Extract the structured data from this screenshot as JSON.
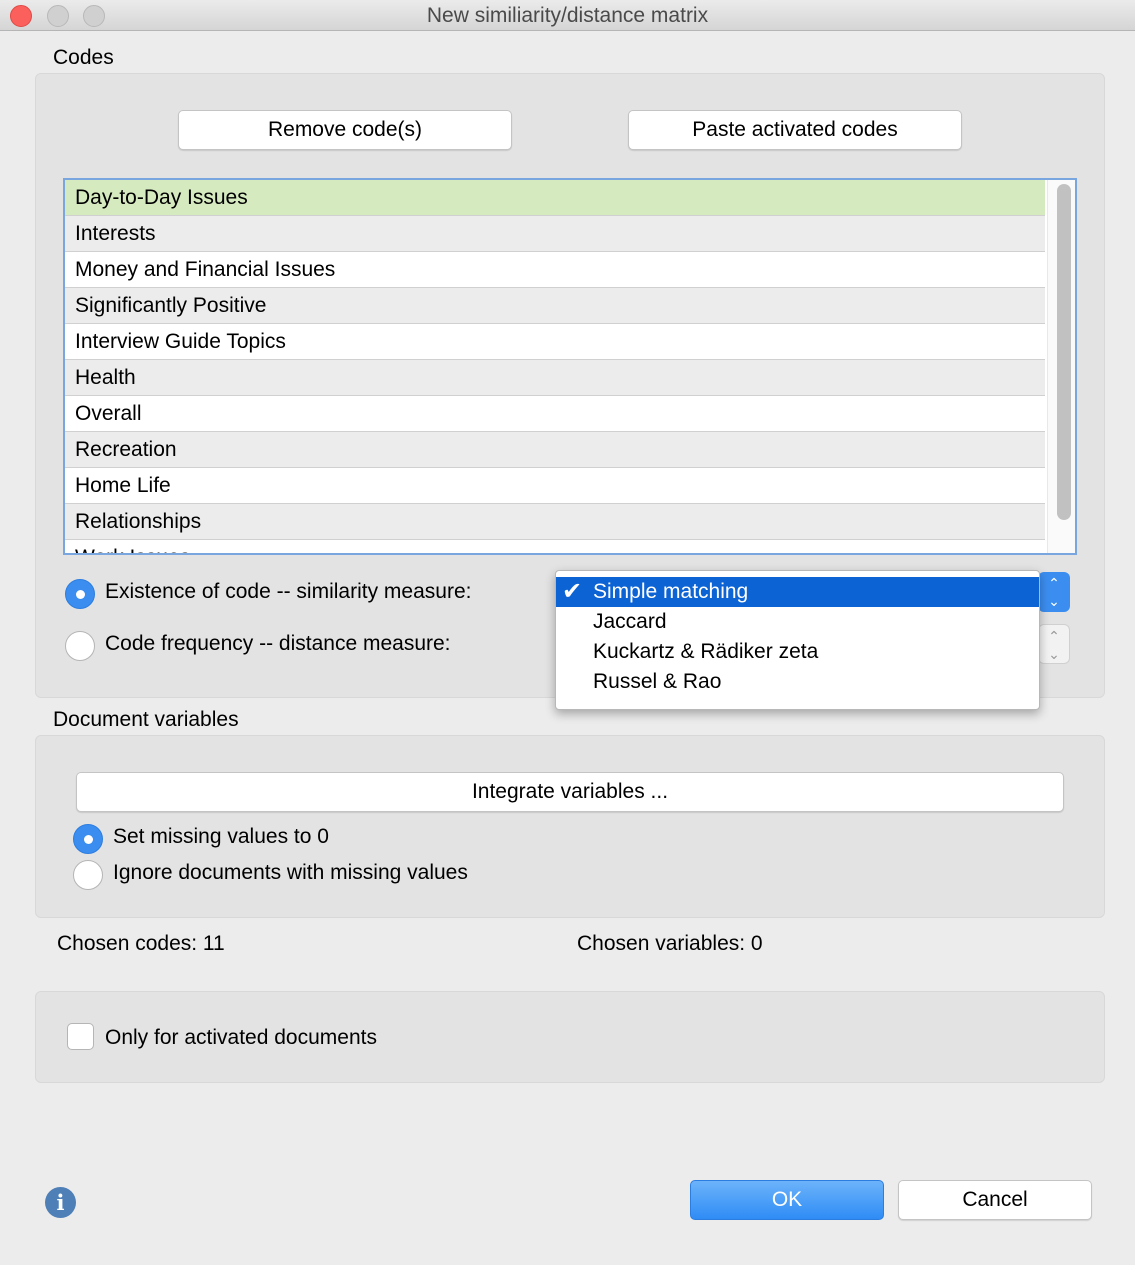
{
  "window": {
    "title": "New similiarity/distance matrix"
  },
  "codes": {
    "section_label": "Codes",
    "remove_button": "Remove code(s)",
    "paste_button": "Paste activated codes",
    "items": [
      "Day-to-Day Issues",
      "Interests",
      "Money and Financial Issues",
      "Significantly Positive",
      "Interview Guide Topics",
      "Health",
      "Overall",
      "Recreation",
      "Home Life",
      "Relationships",
      "Work Issues"
    ],
    "selected_item": "Day-to-Day Issues",
    "existence_label": "Existence of code -- similarity measure:",
    "frequency_label": "Code frequency -- distance measure:",
    "measure_options": [
      "Simple matching",
      "Jaccard",
      "Kuckartz & Rädiker zeta",
      "Russel & Rao"
    ],
    "selected_measure": "Simple matching"
  },
  "variables": {
    "section_label": "Document variables",
    "integrate_button": "Integrate variables ...",
    "missing_zero_label": "Set missing values to 0",
    "ignore_label": "Ignore documents with missing values"
  },
  "summary": {
    "chosen_codes": "Chosen codes: 11",
    "chosen_variables": "Chosen variables: 0"
  },
  "options": {
    "only_activated_label": "Only for activated documents"
  },
  "footer": {
    "ok_label": "OK",
    "cancel_label": "Cancel",
    "info_glyph": "i"
  },
  "colors": {
    "accent": "#3b8ef0",
    "selected_row": "#d6eac0",
    "menu_highlight": "#0c63d4"
  }
}
